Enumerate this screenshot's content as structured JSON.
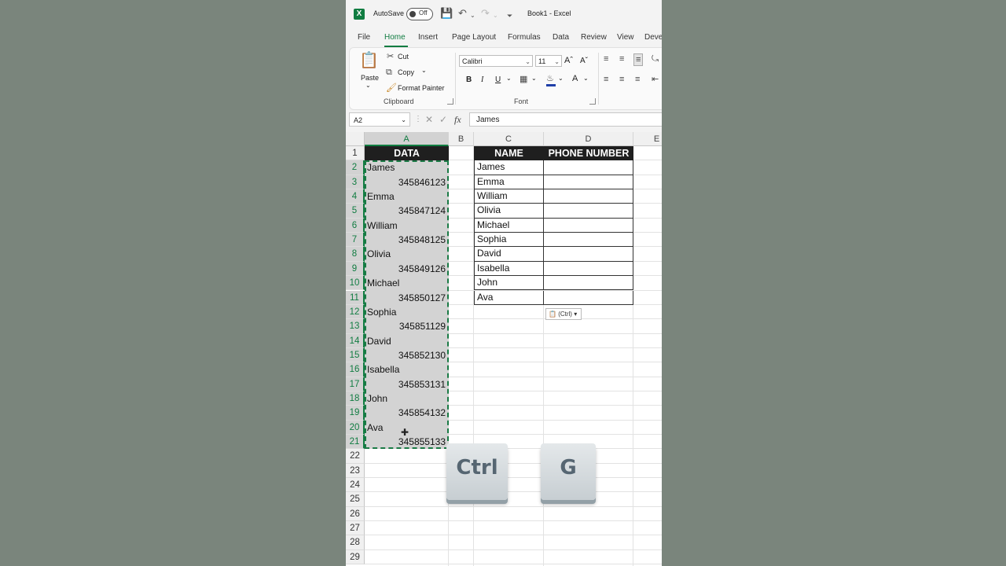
{
  "titlebar": {
    "app_logo": "X",
    "autosave_label": "AutoSave",
    "autosave_state": "Off",
    "doc_title": "Book1  -  Excel"
  },
  "tabs": [
    "File",
    "Home",
    "Insert",
    "Page Layout",
    "Formulas",
    "Data",
    "Review",
    "View",
    "Deve"
  ],
  "active_tab": "Home",
  "ribbon": {
    "clipboard": {
      "paste_label": "Paste",
      "cut_label": "Cut",
      "copy_label": "Copy",
      "format_painter_label": "Format Painter",
      "group_label": "Clipboard"
    },
    "font": {
      "font_name": "Calibri",
      "font_size": "11",
      "bold": "B",
      "italic": "I",
      "underline": "U",
      "group_label": "Font"
    }
  },
  "formula_bar": {
    "name_box": "A2",
    "fx_label": "fx",
    "formula": "James"
  },
  "columns": [
    "A",
    "B",
    "C",
    "D",
    "E"
  ],
  "rows": [
    "1",
    "2",
    "3",
    "4",
    "5",
    "6",
    "7",
    "8",
    "9",
    "10",
    "11",
    "12",
    "13",
    "14",
    "15",
    "16",
    "17",
    "18",
    "19",
    "20",
    "21",
    "22",
    "23",
    "24",
    "25",
    "26",
    "27",
    "28",
    "29"
  ],
  "column_a": {
    "header": "DATA",
    "cells": [
      {
        "value": "James",
        "numeric": false
      },
      {
        "value": "345846123",
        "numeric": true
      },
      {
        "value": "Emma",
        "numeric": false
      },
      {
        "value": "345847124",
        "numeric": true
      },
      {
        "value": "William",
        "numeric": false
      },
      {
        "value": "345848125",
        "numeric": true
      },
      {
        "value": "Olivia",
        "numeric": false
      },
      {
        "value": "345849126",
        "numeric": true
      },
      {
        "value": "Michael",
        "numeric": false
      },
      {
        "value": "345850127",
        "numeric": true
      },
      {
        "value": "Sophia",
        "numeric": false
      },
      {
        "value": "345851129",
        "numeric": true
      },
      {
        "value": "David",
        "numeric": false
      },
      {
        "value": "345852130",
        "numeric": true
      },
      {
        "value": "Isabella",
        "numeric": false
      },
      {
        "value": "345853131",
        "numeric": true
      },
      {
        "value": "John",
        "numeric": false
      },
      {
        "value": "345854132",
        "numeric": true
      },
      {
        "value": "Ava",
        "numeric": false
      },
      {
        "value": "345855133",
        "numeric": true
      }
    ]
  },
  "lookup_table": {
    "headers": [
      "NAME",
      "PHONE NUMBER"
    ],
    "names": [
      "James",
      "Emma",
      "William",
      "Olivia",
      "Michael",
      "Sophia",
      "David",
      "Isabella",
      "John",
      "Ava"
    ]
  },
  "paste_options_label": "(Ctrl)",
  "keys": [
    "Ctrl",
    "G"
  ],
  "colors": {
    "accent": "#107c41",
    "header_fill": "#1f1f1f",
    "selection_fill": "#d3d3d3"
  }
}
